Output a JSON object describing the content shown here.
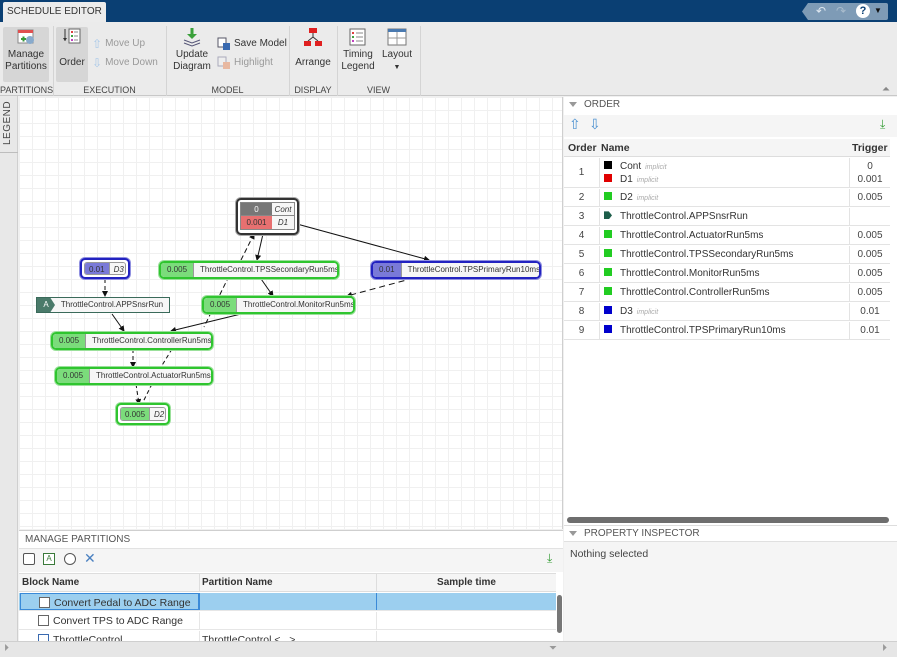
{
  "app": {
    "tab": "SCHEDULE EDITOR",
    "quick_access": {
      "undo": "undo-icon",
      "redo": "redo-icon",
      "help": "help-icon"
    }
  },
  "ribbon": {
    "groups": [
      {
        "label": "PARTITIONS"
      },
      {
        "label": "EXECUTION"
      },
      {
        "label": "MODEL"
      },
      {
        "label": "DISPLAY"
      },
      {
        "label": "VIEW"
      }
    ],
    "manage_partitions": {
      "line1": "Manage",
      "line2": "Partitions"
    },
    "order": "Order",
    "move_up": "Move Up",
    "move_down": "Move Down",
    "update_diagram": {
      "line1": "Update",
      "line2": "Diagram"
    },
    "save_model": "Save Model",
    "highlight": "Highlight",
    "arrange": "Arrange",
    "timing_legend": {
      "line1": "Timing",
      "line2": "Legend"
    },
    "layout": "Layout"
  },
  "legend_tab": "LEGEND",
  "diagram": {
    "nodes": {
      "cont": {
        "rate": "0",
        "name": "Cont"
      },
      "d1": {
        "rate": "0.001",
        "name": "D1"
      },
      "d3": {
        "rate": "0.01",
        "name": "D3"
      },
      "tps_secondary": {
        "rate": "0.005",
        "name": "ThrottleControl.TPSSecondaryRun5ms"
      },
      "tps_primary": {
        "rate": "0.01",
        "name": "ThrottleControl.TPSPrimaryRun10ms"
      },
      "apps": {
        "badge": "A",
        "name": "ThrottleControl.APPSnsrRun"
      },
      "monitor": {
        "rate": "0.005",
        "name": "ThrottleControl.MonitorRun5ms"
      },
      "controller": {
        "rate": "0.005",
        "name": "ThrottleControl.ControllerRun5ms"
      },
      "actuator": {
        "rate": "0.005",
        "name": "ThrottleControl.ActuatorRun5ms"
      },
      "d2": {
        "rate": "0.005",
        "name": "D2"
      }
    }
  },
  "manage_partitions": {
    "title": "MANAGE PARTITIONS",
    "columns": [
      "Block Name",
      "Partition Name",
      "Sample time"
    ],
    "rows": [
      {
        "block": "Convert Pedal to ADC Range",
        "partition": "",
        "sample_time": "",
        "selected": true
      },
      {
        "block": "Convert TPS to ADC Range",
        "partition": "",
        "sample_time": ""
      },
      {
        "block": "ThrottleControl",
        "partition": "ThrottleControl <...>",
        "sample_time": ""
      }
    ]
  },
  "order_panel": {
    "title": "ORDER",
    "columns": [
      "Order",
      "Name",
      "Trigger"
    ],
    "implicit_label": "implicit",
    "rows": [
      {
        "order": "1",
        "entries": [
          {
            "name": "Cont",
            "implicit": true,
            "color": "#000000",
            "trigger": "0"
          },
          {
            "name": "D1",
            "implicit": true,
            "color": "#e00000",
            "trigger": "0.001"
          }
        ]
      },
      {
        "order": "2",
        "entries": [
          {
            "name": "D2",
            "implicit": true,
            "color": "#22cc22",
            "trigger": "0.005"
          }
        ]
      },
      {
        "order": "3",
        "entries": [
          {
            "name": "ThrottleControl.APPSnsrRun",
            "implicit": false,
            "color": "#1d5e4a",
            "trigger": ""
          }
        ]
      },
      {
        "order": "4",
        "entries": [
          {
            "name": "ThrottleControl.ActuatorRun5ms",
            "implicit": false,
            "color": "#22cc22",
            "trigger": "0.005"
          }
        ]
      },
      {
        "order": "5",
        "entries": [
          {
            "name": "ThrottleControl.TPSSecondaryRun5ms",
            "implicit": false,
            "color": "#22cc22",
            "trigger": "0.005"
          }
        ]
      },
      {
        "order": "6",
        "entries": [
          {
            "name": "ThrottleControl.MonitorRun5ms",
            "implicit": false,
            "color": "#22cc22",
            "trigger": "0.005"
          }
        ]
      },
      {
        "order": "7",
        "entries": [
          {
            "name": "ThrottleControl.ControllerRun5ms",
            "implicit": false,
            "color": "#22cc22",
            "trigger": "0.005"
          }
        ]
      },
      {
        "order": "8",
        "entries": [
          {
            "name": "D3",
            "implicit": true,
            "color": "#0000cc",
            "trigger": "0.01"
          }
        ]
      },
      {
        "order": "9",
        "entries": [
          {
            "name": "ThrottleControl.TPSPrimaryRun10ms",
            "implicit": false,
            "color": "#0000cc",
            "trigger": "0.01"
          }
        ]
      }
    ]
  },
  "property_inspector": {
    "title": "PROPERTY INSPECTOR",
    "empty_text": "Nothing selected"
  }
}
